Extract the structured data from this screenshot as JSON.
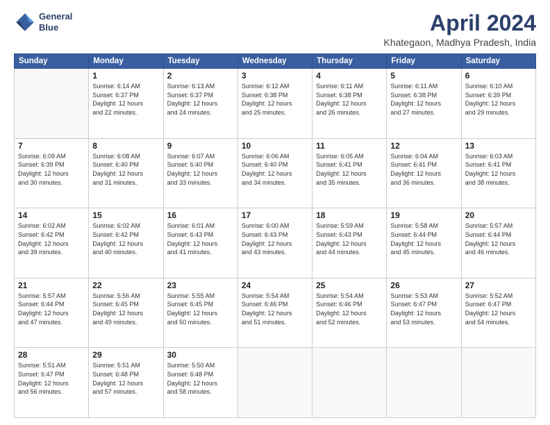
{
  "header": {
    "logo_line1": "General",
    "logo_line2": "Blue",
    "title": "April 2024",
    "subtitle": "Khategaon, Madhya Pradesh, India"
  },
  "weekdays": [
    "Sunday",
    "Monday",
    "Tuesday",
    "Wednesday",
    "Thursday",
    "Friday",
    "Saturday"
  ],
  "weeks": [
    [
      {
        "day": "",
        "info": ""
      },
      {
        "day": "1",
        "info": "Sunrise: 6:14 AM\nSunset: 6:37 PM\nDaylight: 12 hours\nand 22 minutes."
      },
      {
        "day": "2",
        "info": "Sunrise: 6:13 AM\nSunset: 6:37 PM\nDaylight: 12 hours\nand 24 minutes."
      },
      {
        "day": "3",
        "info": "Sunrise: 6:12 AM\nSunset: 6:38 PM\nDaylight: 12 hours\nand 25 minutes."
      },
      {
        "day": "4",
        "info": "Sunrise: 6:11 AM\nSunset: 6:38 PM\nDaylight: 12 hours\nand 26 minutes."
      },
      {
        "day": "5",
        "info": "Sunrise: 6:11 AM\nSunset: 6:38 PM\nDaylight: 12 hours\nand 27 minutes."
      },
      {
        "day": "6",
        "info": "Sunrise: 6:10 AM\nSunset: 6:39 PM\nDaylight: 12 hours\nand 29 minutes."
      }
    ],
    [
      {
        "day": "7",
        "info": "Sunrise: 6:09 AM\nSunset: 6:39 PM\nDaylight: 12 hours\nand 30 minutes."
      },
      {
        "day": "8",
        "info": "Sunrise: 6:08 AM\nSunset: 6:40 PM\nDaylight: 12 hours\nand 31 minutes."
      },
      {
        "day": "9",
        "info": "Sunrise: 6:07 AM\nSunset: 6:40 PM\nDaylight: 12 hours\nand 33 minutes."
      },
      {
        "day": "10",
        "info": "Sunrise: 6:06 AM\nSunset: 6:40 PM\nDaylight: 12 hours\nand 34 minutes."
      },
      {
        "day": "11",
        "info": "Sunrise: 6:05 AM\nSunset: 6:41 PM\nDaylight: 12 hours\nand 35 minutes."
      },
      {
        "day": "12",
        "info": "Sunrise: 6:04 AM\nSunset: 6:41 PM\nDaylight: 12 hours\nand 36 minutes."
      },
      {
        "day": "13",
        "info": "Sunrise: 6:03 AM\nSunset: 6:41 PM\nDaylight: 12 hours\nand 38 minutes."
      }
    ],
    [
      {
        "day": "14",
        "info": "Sunrise: 6:02 AM\nSunset: 6:42 PM\nDaylight: 12 hours\nand 39 minutes."
      },
      {
        "day": "15",
        "info": "Sunrise: 6:02 AM\nSunset: 6:42 PM\nDaylight: 12 hours\nand 40 minutes."
      },
      {
        "day": "16",
        "info": "Sunrise: 6:01 AM\nSunset: 6:43 PM\nDaylight: 12 hours\nand 41 minutes."
      },
      {
        "day": "17",
        "info": "Sunrise: 6:00 AM\nSunset: 6:43 PM\nDaylight: 12 hours\nand 43 minutes."
      },
      {
        "day": "18",
        "info": "Sunrise: 5:59 AM\nSunset: 6:43 PM\nDaylight: 12 hours\nand 44 minutes."
      },
      {
        "day": "19",
        "info": "Sunrise: 5:58 AM\nSunset: 6:44 PM\nDaylight: 12 hours\nand 45 minutes."
      },
      {
        "day": "20",
        "info": "Sunrise: 5:57 AM\nSunset: 6:44 PM\nDaylight: 12 hours\nand 46 minutes."
      }
    ],
    [
      {
        "day": "21",
        "info": "Sunrise: 5:57 AM\nSunset: 6:44 PM\nDaylight: 12 hours\nand 47 minutes."
      },
      {
        "day": "22",
        "info": "Sunrise: 5:56 AM\nSunset: 6:45 PM\nDaylight: 12 hours\nand 49 minutes."
      },
      {
        "day": "23",
        "info": "Sunrise: 5:55 AM\nSunset: 6:45 PM\nDaylight: 12 hours\nand 50 minutes."
      },
      {
        "day": "24",
        "info": "Sunrise: 5:54 AM\nSunset: 6:46 PM\nDaylight: 12 hours\nand 51 minutes."
      },
      {
        "day": "25",
        "info": "Sunrise: 5:54 AM\nSunset: 6:46 PM\nDaylight: 12 hours\nand 52 minutes."
      },
      {
        "day": "26",
        "info": "Sunrise: 5:53 AM\nSunset: 6:47 PM\nDaylight: 12 hours\nand 53 minutes."
      },
      {
        "day": "27",
        "info": "Sunrise: 5:52 AM\nSunset: 6:47 PM\nDaylight: 12 hours\nand 54 minutes."
      }
    ],
    [
      {
        "day": "28",
        "info": "Sunrise: 5:51 AM\nSunset: 6:47 PM\nDaylight: 12 hours\nand 56 minutes."
      },
      {
        "day": "29",
        "info": "Sunrise: 5:51 AM\nSunset: 6:48 PM\nDaylight: 12 hours\nand 57 minutes."
      },
      {
        "day": "30",
        "info": "Sunrise: 5:50 AM\nSunset: 6:48 PM\nDaylight: 12 hours\nand 58 minutes."
      },
      {
        "day": "",
        "info": ""
      },
      {
        "day": "",
        "info": ""
      },
      {
        "day": "",
        "info": ""
      },
      {
        "day": "",
        "info": ""
      }
    ]
  ]
}
